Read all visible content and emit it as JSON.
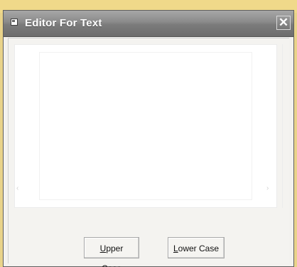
{
  "window": {
    "title": "Editor For Text",
    "close_glyph": "✕"
  },
  "editor": {
    "content": ""
  },
  "buttons": {
    "upper_case": {
      "mnemonic": "U",
      "rest": "pper Case"
    },
    "lower_case": {
      "mnemonic": "L",
      "rest": "ower Case"
    }
  },
  "icons": {
    "app": "app-window-icon",
    "close": "close-icon"
  }
}
